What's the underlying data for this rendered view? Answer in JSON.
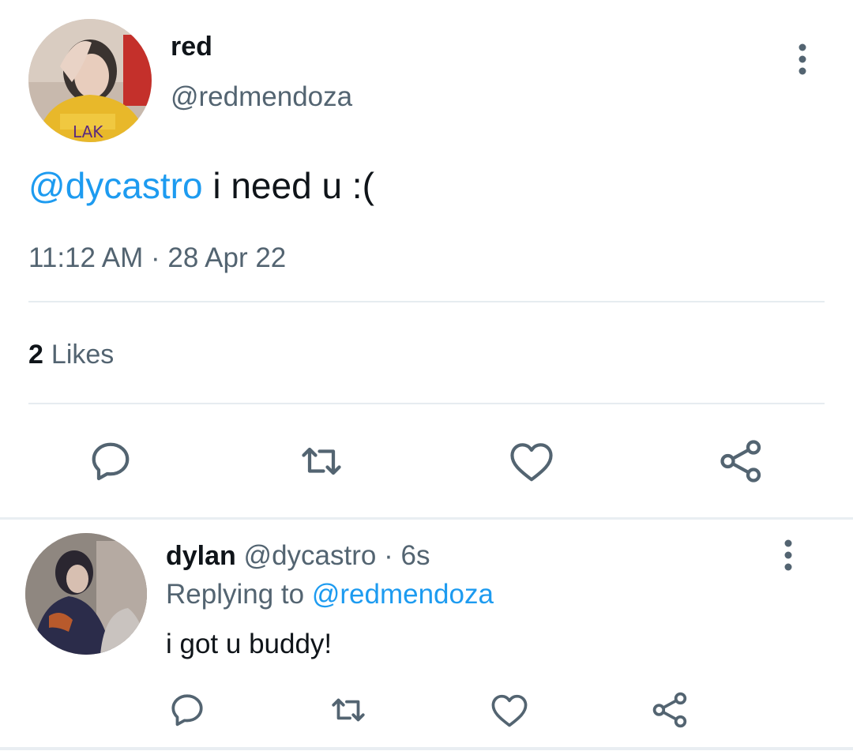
{
  "main_tweet": {
    "display_name": "red",
    "handle": "@redmendoza",
    "mention": "@dycastro",
    "text": " i need u :(",
    "time": "11:12 AM",
    "separator": "·",
    "date": "28 Apr 22",
    "likes_count": "2",
    "likes_label": "Likes"
  },
  "reply": {
    "display_name": "dylan",
    "handle": "@dycastro",
    "separator": "·",
    "time": "6s",
    "replying_prefix": "Replying to",
    "replying_to": "@redmendoza",
    "text": "i got u buddy!"
  },
  "icons": {
    "reply": "reply-icon",
    "retweet": "retweet-icon",
    "like": "heart-icon",
    "share": "share-icon",
    "menu": "more-vertical-icon"
  },
  "colors": {
    "text": "#0f1419",
    "secondary": "#536471",
    "link": "#1d9bf0",
    "divider": "#e6ecf0"
  }
}
